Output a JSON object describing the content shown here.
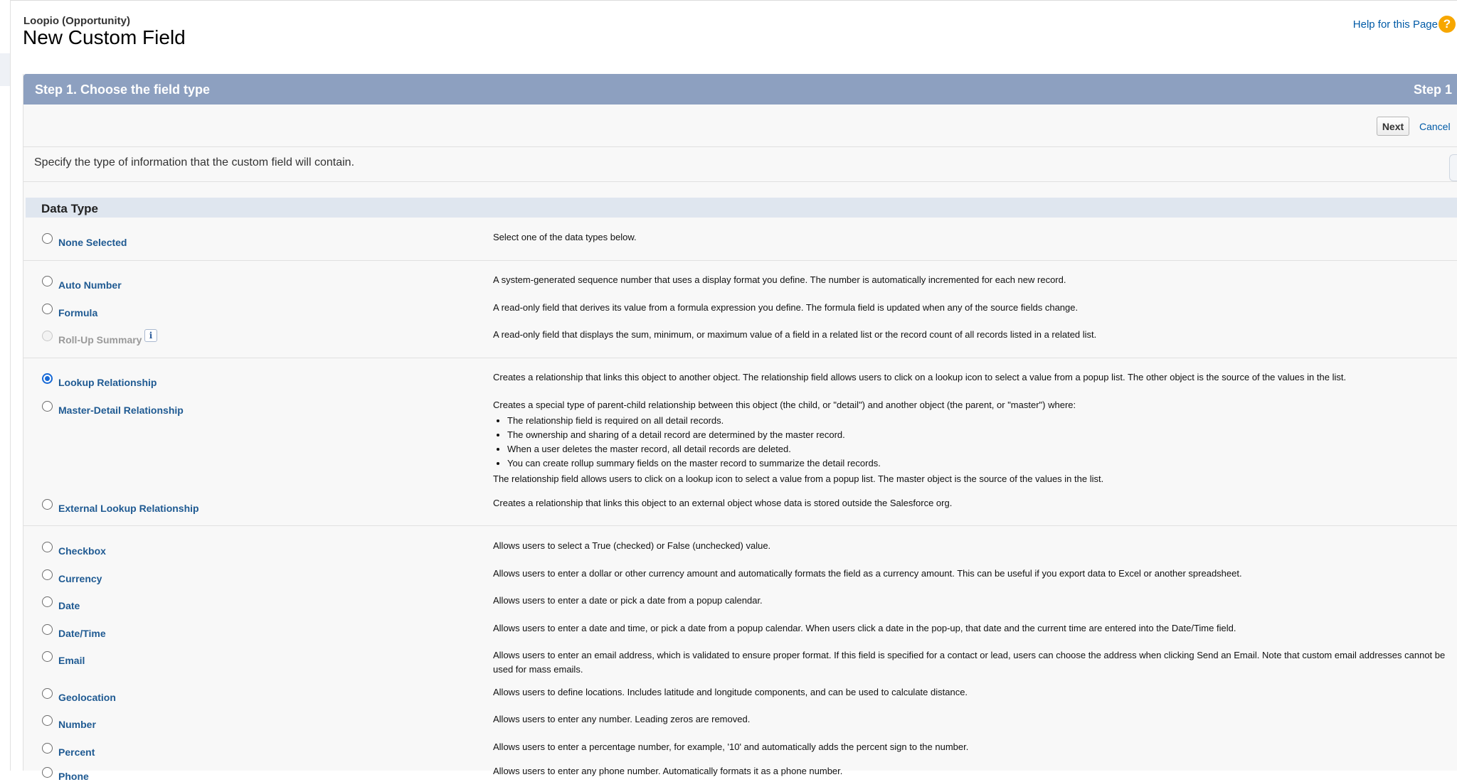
{
  "header": {
    "object_name": "Loopio (Opportunity)",
    "title": "New Custom Field",
    "help_link": "Help for this Page",
    "help_icon": "?"
  },
  "step": {
    "title": "Step 1. Choose the field type",
    "number": "Step 1"
  },
  "buttons": {
    "next": "Next",
    "cancel": "Cancel"
  },
  "intro": "Specify the type of information that the custom field will contain.",
  "section_title": "Data Type",
  "data_types": [
    {
      "label": "None Selected",
      "desc": "Select one of the data types below.",
      "state": "unchecked"
    },
    {
      "label": "Auto Number",
      "desc": "A system-generated sequence number that uses a display format you define. The number is automatically incremented for each new record.",
      "state": "unchecked"
    },
    {
      "label": "Formula",
      "desc": "A read-only field that derives its value from a formula expression you define. The formula field is updated when any of the source fields change.",
      "state": "unchecked"
    },
    {
      "label": "Roll-Up Summary",
      "desc": "A read-only field that displays the sum, minimum, or maximum value of a field in a related list or the record count of all records listed in a related list.",
      "state": "disabled",
      "info_icon": "i"
    },
    {
      "label": "Lookup Relationship",
      "desc": "Creates a relationship that links this object to another object. The relationship field allows users to click on a lookup icon to select a value from a popup list. The other object is the source of the values in the list.",
      "state": "checked"
    },
    {
      "label": "Master-Detail Relationship",
      "desc": "Creates a special type of parent-child relationship between this object (the child, or \"detail\") and another object (the parent, or \"master\") where:",
      "state": "unchecked",
      "bullets": [
        "The relationship field is required on all detail records.",
        "The ownership and sharing of a detail record are determined by the master record.",
        "When a user deletes the master record, all detail records are deleted.",
        "You can create rollup summary fields on the master record to summarize the detail records."
      ],
      "desc_after": "The relationship field allows users to click on a lookup icon to select a value from a popup list. The master object is the source of the values in the list."
    },
    {
      "label": "External Lookup Relationship",
      "desc": "Creates a relationship that links this object to an external object whose data is stored outside the Salesforce org.",
      "state": "unchecked"
    },
    {
      "label": "Checkbox",
      "desc": "Allows users to select a True (checked) or False (unchecked) value.",
      "state": "unchecked"
    },
    {
      "label": "Currency",
      "desc": "Allows users to enter a dollar or other currency amount and automatically formats the field as a currency amount. This can be useful if you export data to Excel or another spreadsheet.",
      "state": "unchecked"
    },
    {
      "label": "Date",
      "desc": "Allows users to enter a date or pick a date from a popup calendar.",
      "state": "unchecked"
    },
    {
      "label": "Date/Time",
      "desc": "Allows users to enter a date and time, or pick a date from a popup calendar. When users click a date in the pop-up, that date and the current time are entered into the Date/Time field.",
      "state": "unchecked"
    },
    {
      "label": "Email",
      "desc": "Allows users to enter an email address, which is validated to ensure proper format. If this field is specified for a contact or lead, users can choose the address when clicking Send an Email. Note that custom email addresses cannot be used for mass emails.",
      "state": "unchecked"
    },
    {
      "label": "Geolocation",
      "desc": "Allows users to define locations. Includes latitude and longitude components, and can be used to calculate distance.",
      "state": "unchecked"
    },
    {
      "label": "Number",
      "desc": "Allows users to enter any number. Leading zeros are removed.",
      "state": "unchecked"
    },
    {
      "label": "Percent",
      "desc": "Allows users to enter a percentage number, for example, '10' and automatically adds the percent sign to the number.",
      "state": "unchecked"
    },
    {
      "label": "Phone",
      "desc": "Allows users to enter any phone number. Automatically formats it as a phone number.",
      "state": "unchecked"
    }
  ]
}
